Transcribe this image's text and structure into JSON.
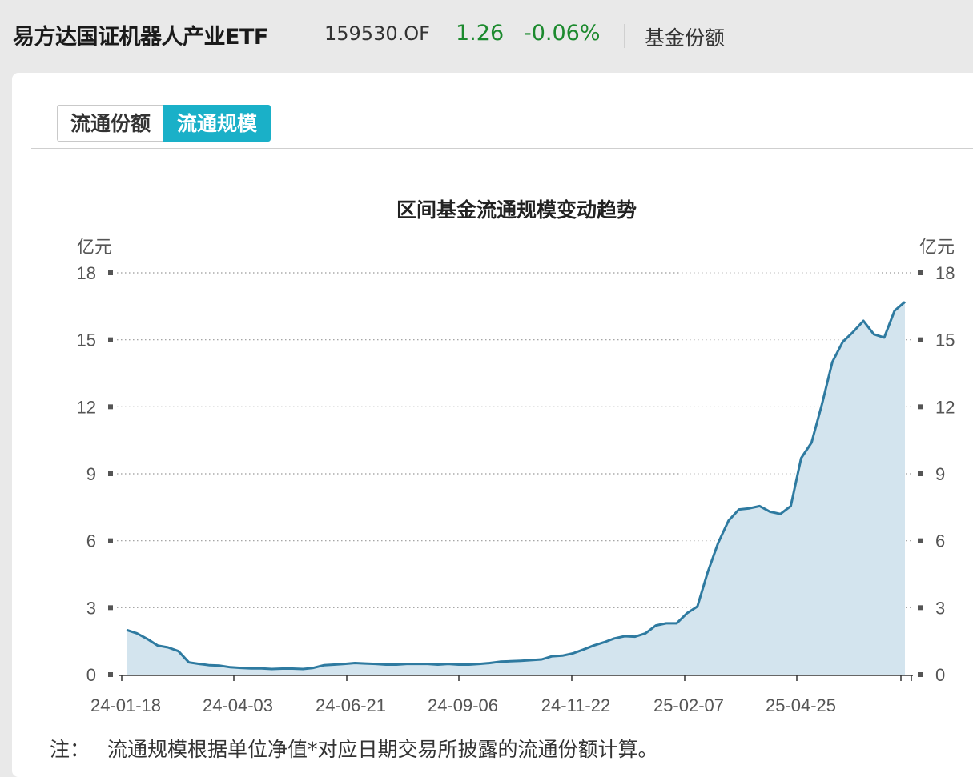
{
  "header": {
    "fund_name": "易方达国证机器人产业ETF",
    "fund_code": "159530.OF",
    "nav": "1.26",
    "change": "-0.06%",
    "fund_share_link": "基金份额"
  },
  "tabs": [
    {
      "label": "流通份额",
      "active": false
    },
    {
      "label": "流通规模",
      "active": true
    }
  ],
  "colors": {
    "accent": "#1ab0c8",
    "positive_green": "#1c8a2e",
    "line": "#2e7aa0",
    "area": "#d3e4ee"
  },
  "chart_data": {
    "type": "area",
    "title": "区间基金流通规模变动趋势",
    "y_unit_left": "亿元",
    "y_unit_right": "亿元",
    "ylim": [
      0,
      18
    ],
    "yticks": [
      0,
      3,
      6,
      9,
      12,
      15,
      18
    ],
    "xticks": [
      "24-01-18",
      "24-04-03",
      "24-06-21",
      "24-09-06",
      "24-11-22",
      "25-02-07",
      "25-04-25"
    ],
    "grid": true,
    "x": [
      "24-01-18",
      "24-01-26",
      "24-02-02",
      "24-02-09",
      "24-02-16",
      "24-02-23",
      "24-03-01",
      "24-03-08",
      "24-03-15",
      "24-03-22",
      "24-03-29",
      "24-04-03",
      "24-04-10",
      "24-04-17",
      "24-04-24",
      "24-05-01",
      "24-05-08",
      "24-05-15",
      "24-05-22",
      "24-05-29",
      "24-06-05",
      "24-06-12",
      "24-06-19",
      "24-06-26",
      "24-07-03",
      "24-07-10",
      "24-07-17",
      "24-07-24",
      "24-07-31",
      "24-08-07",
      "24-08-14",
      "24-08-21",
      "24-08-28",
      "24-09-04",
      "24-09-11",
      "24-09-18",
      "24-09-25",
      "24-10-02",
      "24-10-09",
      "24-10-16",
      "24-10-23",
      "24-10-30",
      "24-11-06",
      "24-11-13",
      "24-11-20",
      "24-11-27",
      "24-12-04",
      "24-12-11",
      "24-12-18",
      "24-12-25",
      "25-01-01",
      "25-01-08",
      "25-01-15",
      "25-01-22",
      "25-01-29",
      "25-02-05",
      "25-02-12",
      "25-02-19",
      "25-02-26",
      "25-03-05",
      "25-03-12",
      "25-03-19",
      "25-03-26",
      "25-04-02",
      "25-04-09",
      "25-04-16",
      "25-04-23",
      "25-04-30",
      "25-05-07",
      "25-05-14",
      "25-05-21",
      "25-05-28",
      "25-06-04",
      "25-06-11",
      "25-06-18",
      "25-06-25"
    ],
    "series": [
      {
        "values": [
          2.0,
          1.85,
          1.6,
          1.3,
          1.22,
          1.05,
          0.55,
          0.48,
          0.42,
          0.4,
          0.33,
          0.3,
          0.28,
          0.28,
          0.25,
          0.27,
          0.27,
          0.25,
          0.3,
          0.42,
          0.45,
          0.48,
          0.52,
          0.5,
          0.48,
          0.45,
          0.45,
          0.48,
          0.48,
          0.48,
          0.45,
          0.48,
          0.45,
          0.45,
          0.48,
          0.52,
          0.58,
          0.6,
          0.62,
          0.65,
          0.68,
          0.82,
          0.85,
          0.95,
          1.12,
          1.3,
          1.45,
          1.62,
          1.72,
          1.7,
          1.85,
          2.2,
          2.3,
          2.3,
          2.75,
          3.05,
          4.6,
          5.9,
          6.9,
          7.4,
          7.45,
          7.55,
          7.3,
          7.2,
          7.55,
          9.7,
          10.4,
          12.1,
          14.0,
          14.9,
          15.35,
          15.85,
          15.25,
          15.1,
          16.3,
          16.7
        ]
      }
    ]
  },
  "note": {
    "prefix": "注：",
    "text": "流通规模根据单位净值*对应日期交易所披露的流通份额计算。"
  }
}
